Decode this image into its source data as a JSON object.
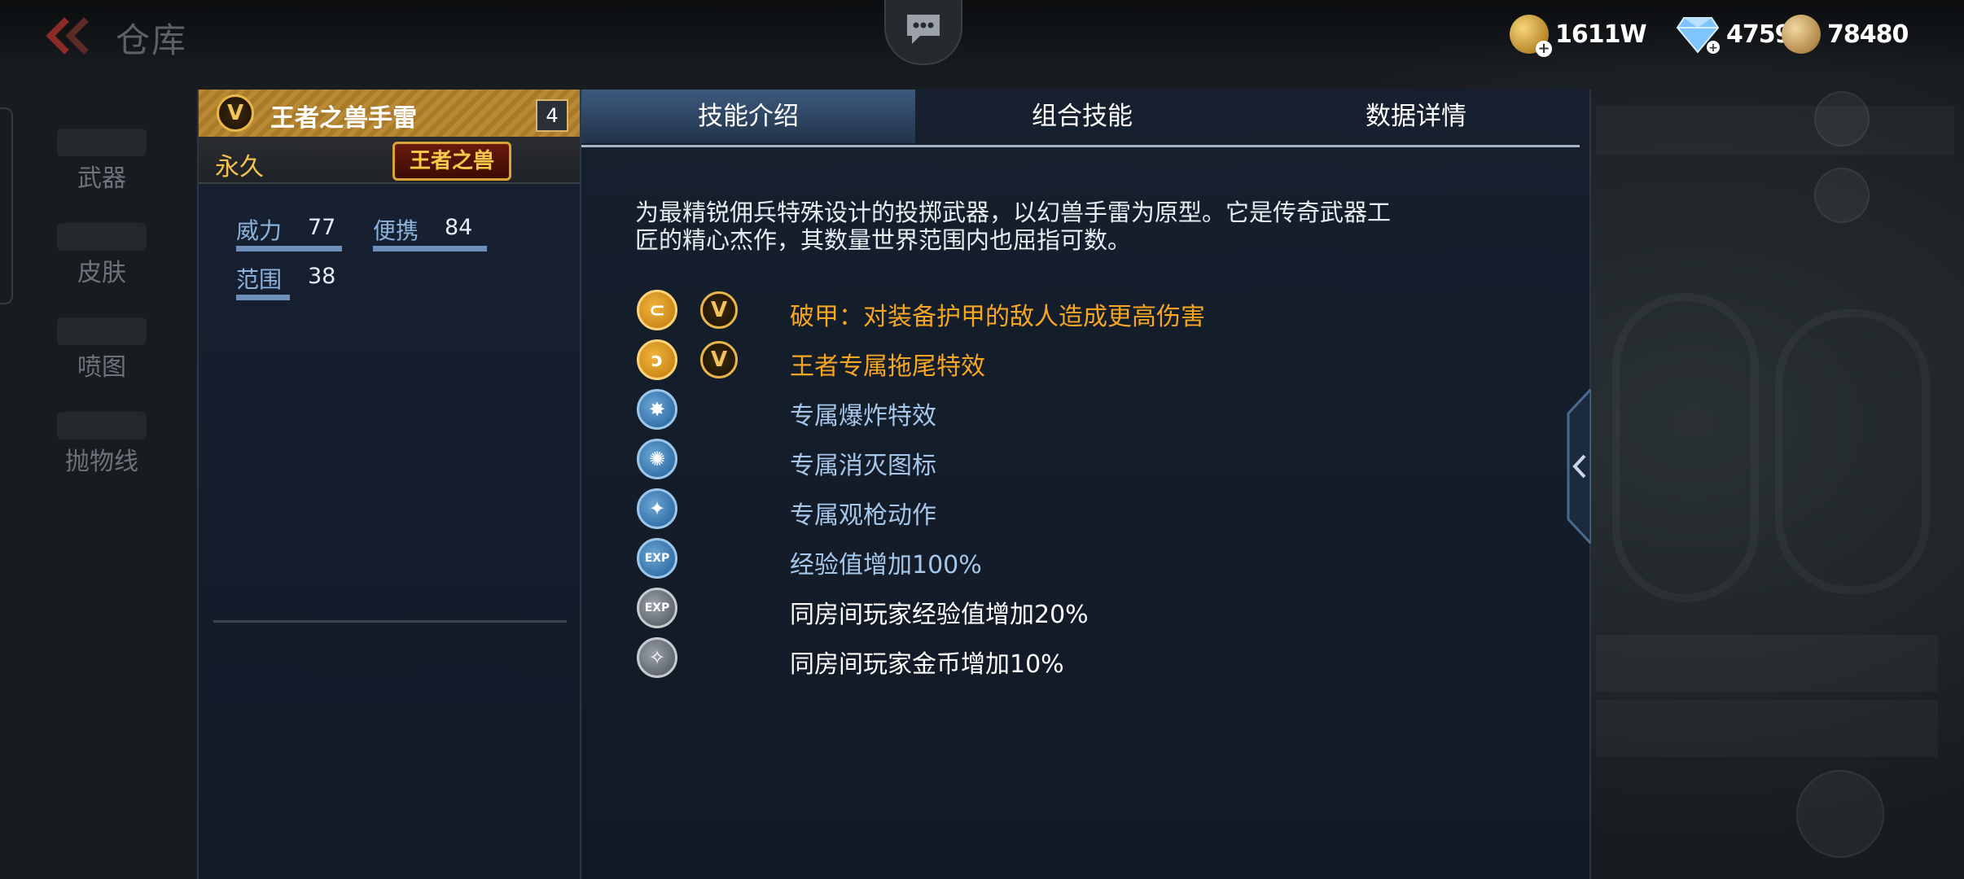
{
  "header": {
    "title": "仓库",
    "currencies": [
      {
        "icon": "gold-coin-icon",
        "value": "1611W"
      },
      {
        "icon": "diamond-icon",
        "value": "4759"
      },
      {
        "icon": "honor-coin-icon",
        "value": "78480"
      }
    ]
  },
  "sidebar": {
    "items": [
      {
        "label": "武器"
      },
      {
        "label": "皮肤"
      },
      {
        "label": "喷图"
      },
      {
        "label": "抛物线"
      }
    ]
  },
  "item": {
    "name": "王者之兽手雷",
    "count": "4",
    "duration": "永久",
    "series": "王者之兽",
    "stats": [
      {
        "name": "威力",
        "value": "77"
      },
      {
        "name": "便携",
        "value": "84"
      },
      {
        "name": "范围",
        "value": "38"
      }
    ]
  },
  "tabs": [
    {
      "label": "技能介绍",
      "active": true
    },
    {
      "label": "组合技能",
      "active": false
    },
    {
      "label": "数据详情",
      "active": false
    }
  ],
  "detail": {
    "description_line1": "为最精锐佣兵特殊设计的投掷武器，以幻兽手雷为原型。它是传奇武器工",
    "description_line2": "匠的精心杰作，其数量世界范围内也屈指可数。",
    "features": [
      {
        "icon": "armor-break-icon",
        "style": "gold",
        "v_badge": true,
        "text": "破甲：对装备护甲的敌人造成更高伤害"
      },
      {
        "icon": "trail-effect-icon",
        "style": "gold",
        "v_badge": true,
        "text": "王者专属拖尾特效"
      },
      {
        "icon": "explosion-effect-icon",
        "style": "blue",
        "v_badge": false,
        "text": "专属爆炸特效"
      },
      {
        "icon": "kill-icon-icon",
        "style": "blue",
        "v_badge": false,
        "text": "专属消灭图标"
      },
      {
        "icon": "inspect-action-icon",
        "style": "blue",
        "v_badge": false,
        "text": "专属观枪动作"
      },
      {
        "icon": "exp-boost-icon",
        "style": "blue",
        "v_badge": false,
        "text": "经验值增加100%"
      },
      {
        "icon": "room-exp-boost-icon",
        "style": "grey",
        "v_badge": false,
        "text": "同房间玩家经验值增加20%"
      },
      {
        "icon": "room-gold-boost-icon",
        "style": "grey",
        "v_badge": false,
        "text": "同房间玩家金币增加10%"
      }
    ]
  },
  "v_badge_text": "V",
  "icon_glyphs": {
    "armor-break": "⊂",
    "trail": "ↄ",
    "explosion": "✸",
    "kill": "✺",
    "inspect": "✦",
    "exp": "EXP",
    "room-gold": "✧"
  },
  "colors": {
    "accent_gold": "#f7a623",
    "accent_blue": "#a6c6ea",
    "tab_active": "#3c5a7d"
  }
}
